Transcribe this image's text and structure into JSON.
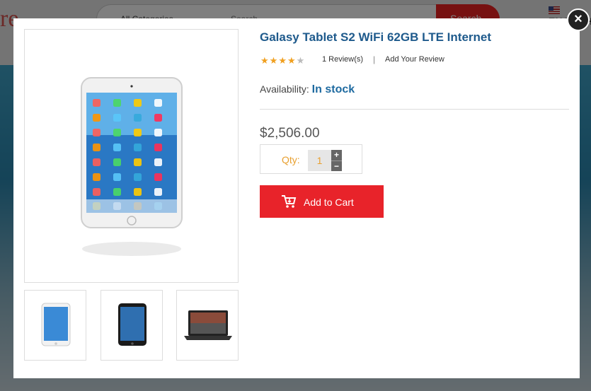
{
  "background": {
    "logo_fragment": "re",
    "category_select": "All Categories",
    "search_placeholder": "Search...",
    "search_button": "Search",
    "language": "ENGLISH"
  },
  "modal": {
    "close_label": "×",
    "product": {
      "title": "Galasy Tablet S2 WiFi 62GB LTE Internet",
      "rating": 4,
      "rating_max": 5,
      "reviews_label": "1 Review(s)",
      "separator": "|",
      "add_review_label": "Add Your Review",
      "availability_label": "Availability:",
      "availability_value": "In stock",
      "price": "$2,506.00",
      "qty_label": "Qty:",
      "qty_value": "1",
      "qty_up": "+",
      "qty_down": "−",
      "add_to_cart": "Add to Cart"
    },
    "thumbnails": [
      "white-tablet",
      "black-tablet",
      "laptop"
    ]
  },
  "colors": {
    "title": "#1e5a8c",
    "availability": "#1e6aa0",
    "add_to_cart": "#e8232a",
    "star_on": "#f0a020",
    "star_off": "#bbbbbb",
    "qty_text": "#e8a030"
  }
}
